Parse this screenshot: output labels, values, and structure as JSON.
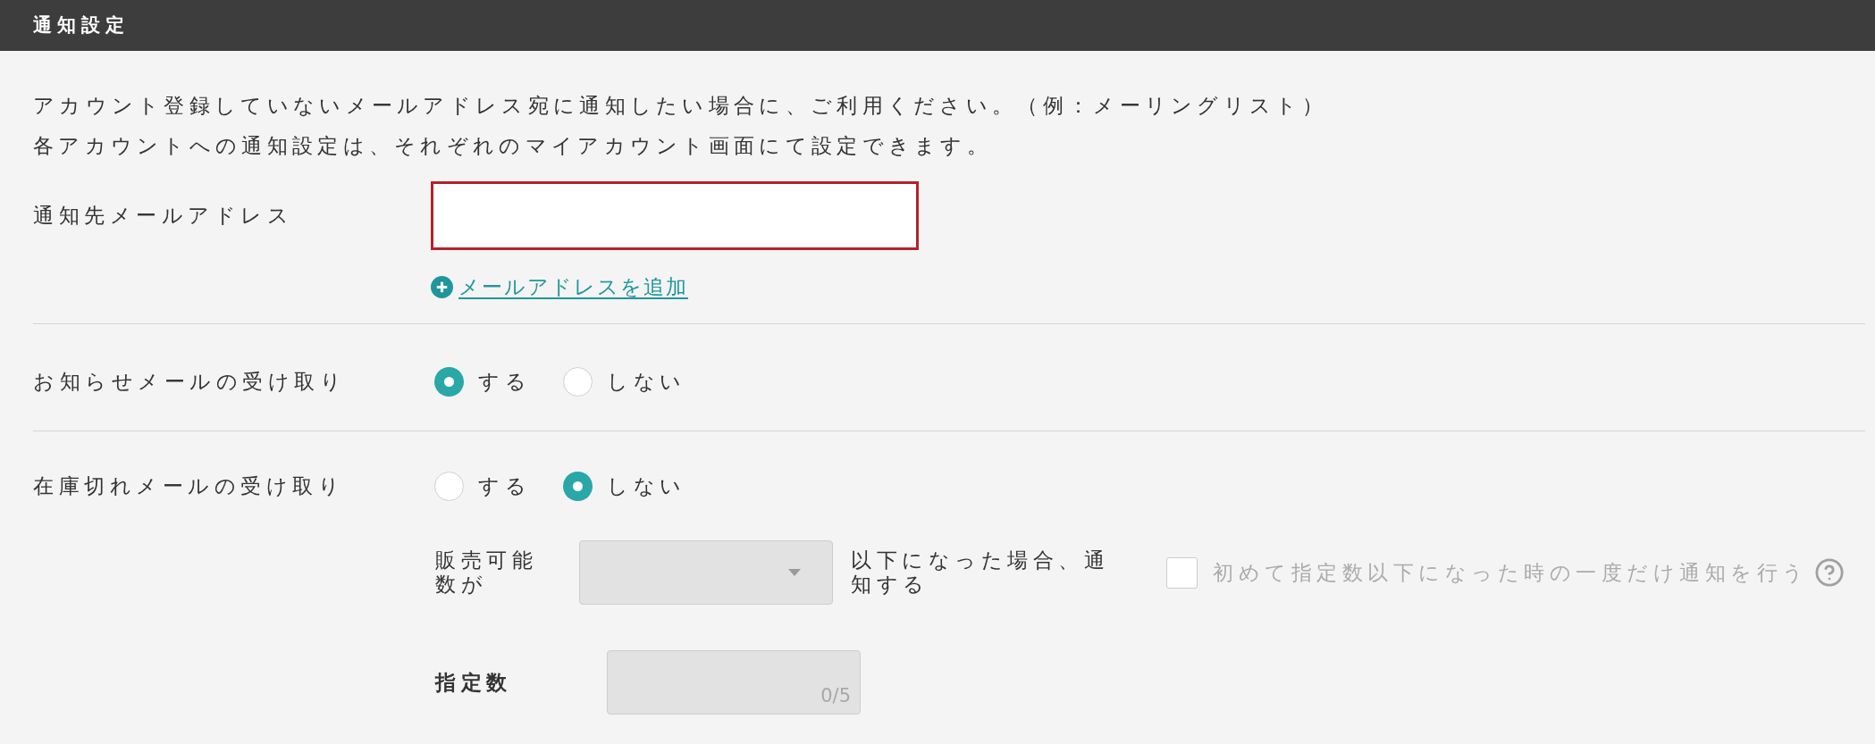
{
  "header": {
    "title": "通知設定"
  },
  "intro": [
    "アカウント登録していないメールアドレス宛に通知したい場合に、ご利用ください。（例：メーリングリスト）",
    "各アカウントへの通知設定は、それぞれのマイアカウント画面にて設定できます。"
  ],
  "email": {
    "label": "通知先メールアドレス",
    "field": {
      "invalid": true
    },
    "add_link": {
      "label": "メールアドレスを追加"
    }
  },
  "settings": [
    {
      "label": "お知らせメールの受け取り",
      "options": [
        {
          "label": "する",
          "selected": true
        },
        {
          "label": "しない",
          "selected": false
        }
      ]
    },
    {
      "label": "在庫切れメールの受け取り",
      "options": [
        {
          "label": "する",
          "selected": false
        },
        {
          "label": "しない",
          "selected": true
        }
      ],
      "threshold": {
        "prefix": "販売可能数が",
        "select": {
          "disabled": true
        },
        "suffix": "以下になった場合、通知する",
        "once_option": {
          "label": "初めて指定数以下になった時の一度だけ通知を行う",
          "checked": false,
          "disabled": true
        },
        "count_field": {
          "label": "指定数",
          "counter": "0/5",
          "disabled": true
        }
      }
    }
  ]
}
